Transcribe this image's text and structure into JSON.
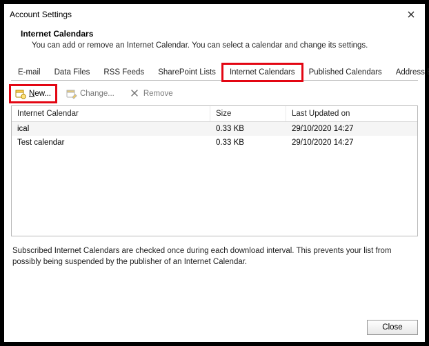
{
  "window": {
    "title": "Account Settings"
  },
  "header": {
    "title": "Internet Calendars",
    "subtitle": "You can add or remove an Internet Calendar. You can select a calendar and change its settings."
  },
  "tabs": [
    {
      "label": "E-mail",
      "active": false
    },
    {
      "label": "Data Files",
      "active": false
    },
    {
      "label": "RSS Feeds",
      "active": false
    },
    {
      "label": "SharePoint Lists",
      "active": false
    },
    {
      "label": "Internet Calendars",
      "active": true,
      "highlight": true
    },
    {
      "label": "Published Calendars",
      "active": false
    },
    {
      "label": "Address Books",
      "active": false
    }
  ],
  "toolbar": {
    "new_label": "New...",
    "change_label": "Change...",
    "remove_label": "Remove"
  },
  "columns": {
    "c0": "Internet Calendar",
    "c1": "Size",
    "c2": "Last Updated on"
  },
  "rows": [
    {
      "name": "ical",
      "size": "0.33 KB",
      "updated": "29/10/2020 14:27"
    },
    {
      "name": "Test calendar",
      "size": "0.33 KB",
      "updated": "29/10/2020 14:27"
    }
  ],
  "info": "Subscribed Internet Calendars are checked once during each download interval. This prevents your list from possibly being suspended by the publisher of an Internet Calendar.",
  "footer": {
    "close": "Close"
  }
}
